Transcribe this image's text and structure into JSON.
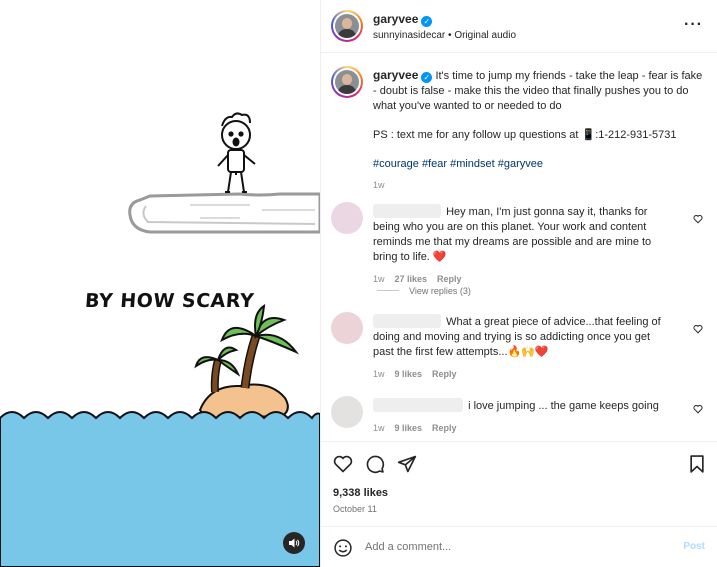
{
  "media": {
    "art_caption": "BY HOW SCARY",
    "sound_icon": "speaker-icon"
  },
  "header": {
    "username": "garyvee",
    "verified": true,
    "subtitle": "sunnyinasidecar • Original audio",
    "more_icon": "more-dots-icon",
    "more_label": "···"
  },
  "caption": {
    "username": "garyvee",
    "line1": "It's time to jump my friends - take the leap - fear is fake - doubt is false - make this the video that finally pushes you to do what you've wanted to or needed to do",
    "line2": "PS : text me for any follow up questions at 📱:1-212-931-5731",
    "hashtags": [
      "#courage",
      "#fear",
      "#mindset",
      "#garyvee"
    ],
    "time": "1w"
  },
  "comments": [
    {
      "text": "Hey man, I'm just gonna say it, thanks for being who you are on this planet. Your work and content reminds me that my dreams are possible and are mine to bring to life. ❤️",
      "time": "1w",
      "likes": "27 likes",
      "reply": "Reply",
      "avatar_color": "#ead7e3"
    },
    {
      "text": "What a great piece of advice...that feeling of doing and moving and trying is so addicting once you get past the first few attempts...🔥🙌❤️",
      "time": "1w",
      "likes": "9 likes",
      "reply": "Reply",
      "avatar_color": "#ecd3d8"
    },
    {
      "text": "i love jumping ... the game keeps going",
      "time": "1w",
      "likes": "9 likes",
      "reply": "Reply",
      "avatar_color": "#e4e1e1"
    }
  ],
  "view_replies": "View replies (3)",
  "actions": {
    "likes": "9,338 likes",
    "date": "October 11"
  },
  "add_comment": {
    "placeholder": "Add a comment...",
    "post_label": "Post"
  },
  "colors": {
    "water": "#79c7e8",
    "sand": "#f3c28f",
    "palm": "#6fbf59",
    "accent": "#0095f6",
    "link": "#00376b"
  }
}
